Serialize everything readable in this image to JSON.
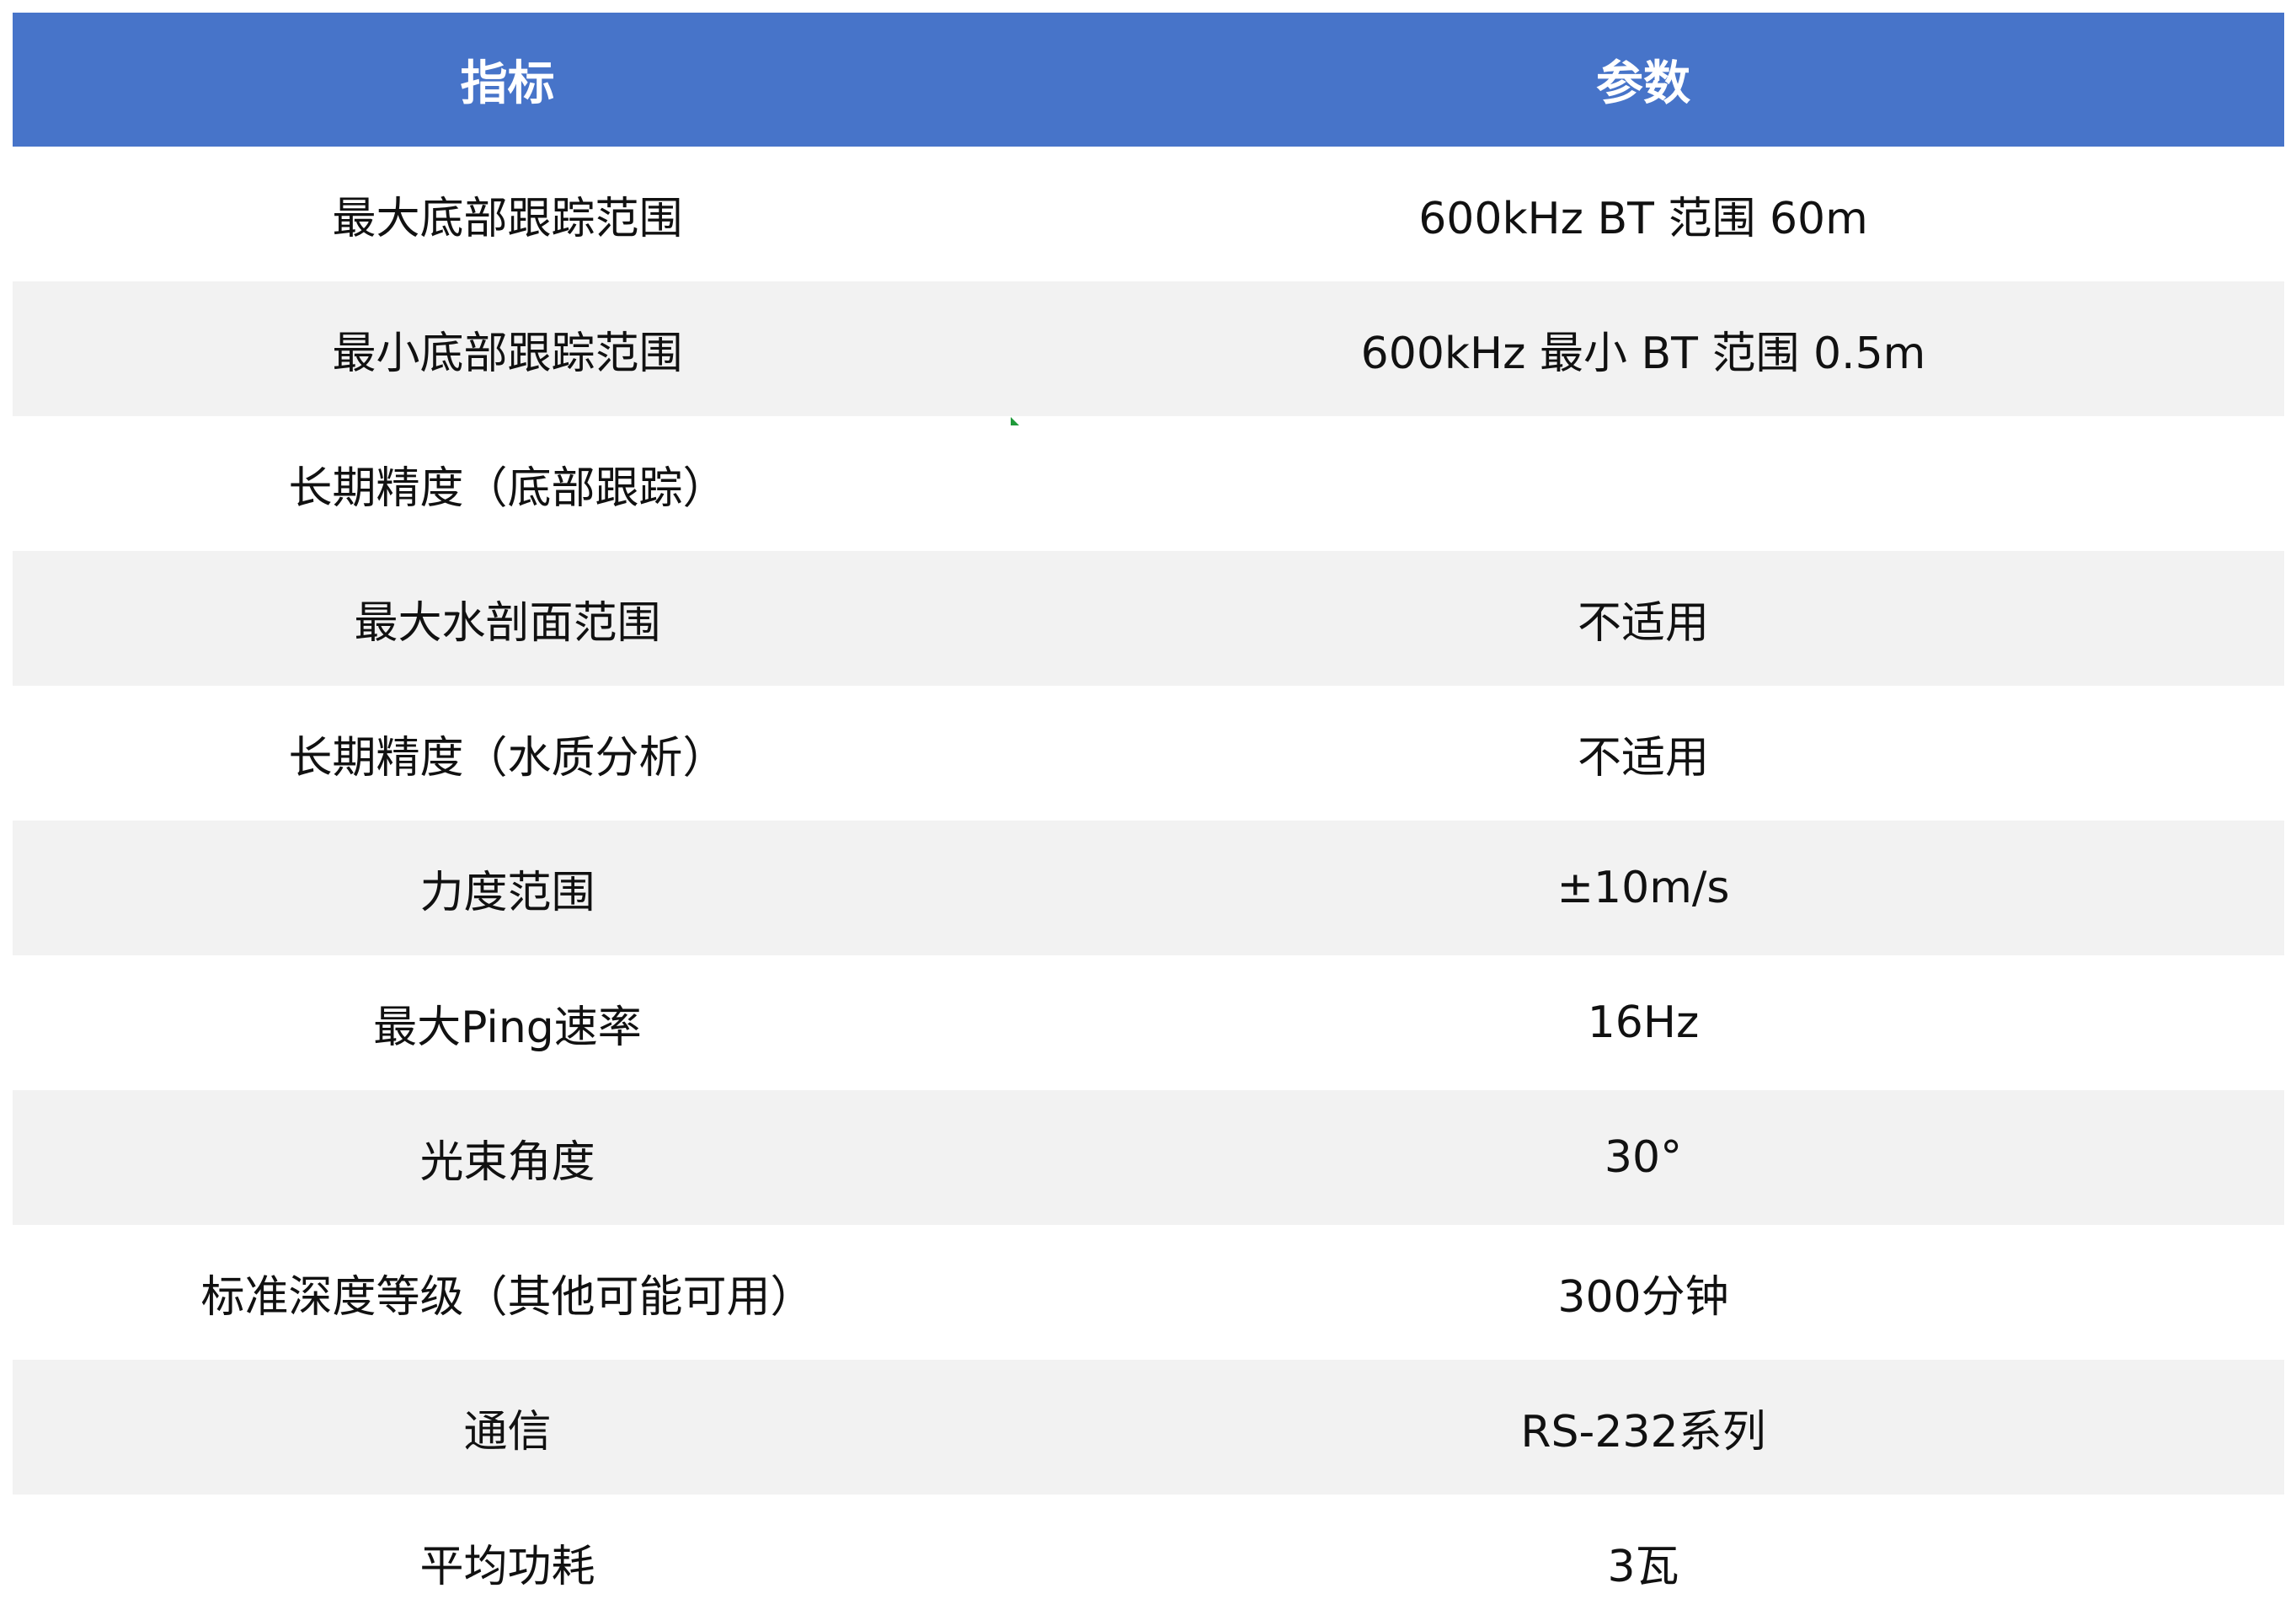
{
  "table": {
    "headers": [
      "指标",
      "参数"
    ],
    "rows": [
      {
        "metric": "最大底部跟踪范围",
        "param": "600kHz BT 范围 60m"
      },
      {
        "metric": "最小底部跟踪范围",
        "param": "600kHz 最小 BT 范围 0.5m"
      },
      {
        "metric": "长期精度（底部跟踪）",
        "param": ""
      },
      {
        "metric": "最大水剖面范围",
        "param": "不适用"
      },
      {
        "metric": "长期精度（水质分析）",
        "param": "不适用"
      },
      {
        "metric": "力度范围",
        "param": "±10m/s"
      },
      {
        "metric": "最大Ping速率",
        "param": "16Hz"
      },
      {
        "metric": "光束角度",
        "param": "30°"
      },
      {
        "metric": "标准深度等级（其他可能可用）",
        "param": "300分钟"
      },
      {
        "metric": "通信",
        "param": "RS-232系列"
      },
      {
        "metric": "平均功耗",
        "param": "3瓦"
      }
    ]
  }
}
